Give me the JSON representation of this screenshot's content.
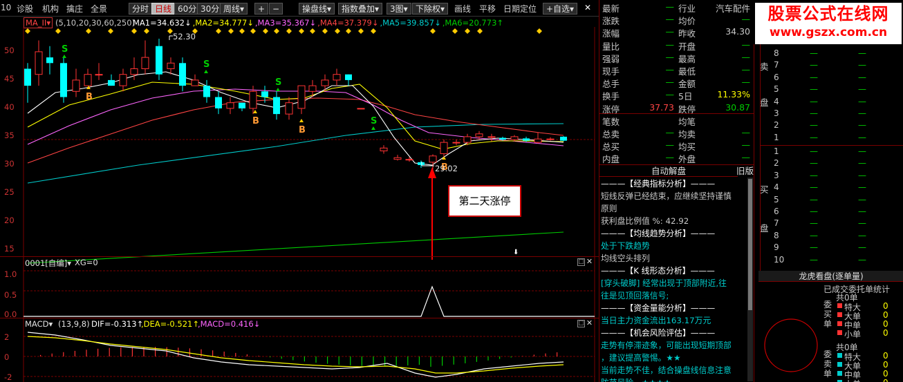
{
  "toolbar": {
    "left_number": "10",
    "items": [
      "诊股",
      "机构",
      "擒庄",
      "全景"
    ],
    "period_buttons": [
      "分时",
      "日线",
      "60分",
      "30分",
      "周线▾"
    ],
    "active_period": "日线",
    "plus": "+",
    "minus": "−",
    "dropdowns": [
      "操盘线▾",
      "指数叠加▾",
      "3图▾",
      "下除权▾"
    ],
    "items2": [
      "画线",
      "平移",
      "日期定位",
      "+自选▾"
    ],
    "close": "✕"
  },
  "main_panel": {
    "indicator_select": "MA_II▾",
    "params": "(5,10,20,30,60,250)",
    "ma_labels": [
      {
        "text": "MA1=34.632↓",
        "color": "#ffffff"
      },
      {
        "text": ",MA2=34.777↓",
        "color": "#ffff00"
      },
      {
        "text": ",MA3=35.367↓",
        "color": "#ff66ff"
      },
      {
        "text": ",MA4=37.379↓",
        "color": "#ff4444"
      },
      {
        "text": ",MA5=39.857↓",
        "color": "#00cccc"
      },
      {
        "text": ",MA6=20.773↑",
        "color": "#00cc00"
      }
    ],
    "y_ticks": [
      "50",
      "45",
      "40",
      "35",
      "30",
      "25",
      "20",
      "15"
    ],
    "high_label": "52.30",
    "low_label": "29.02",
    "annotation": "第二天涨停",
    "s_mark": "S",
    "b_mark": "B"
  },
  "indicator_panel": {
    "title": "0001[自编]▾",
    "xg": "XG=0",
    "y_ticks": [
      "1.0",
      "0.5",
      "0.0"
    ]
  },
  "macd_panel": {
    "name": "MACD▾",
    "params": "(13,9,8)",
    "dif": "DIF=-0.313↑",
    "dea": ",DEA=-0.521↑",
    "macd": ",MACD=0.416↓",
    "y_ticks": [
      "2",
      "0",
      "-2"
    ]
  },
  "quote_table": {
    "rows": [
      {
        "l": "最新",
        "lv": "—",
        "r": "行业",
        "rv": "汽车配件"
      },
      {
        "l": "涨跌",
        "lv": "—",
        "r": "均价",
        "rv": "—"
      },
      {
        "l": "涨幅",
        "lv": "—",
        "r": "昨收",
        "rv": "34.30"
      },
      {
        "l": "量比",
        "lv": "—",
        "r": "开盘",
        "rv": "—"
      },
      {
        "l": "强弱",
        "lv": "—",
        "r": "最高",
        "rv": "—"
      },
      {
        "l": "现手",
        "lv": "—",
        "r": "最低",
        "rv": "—"
      },
      {
        "l": "总手",
        "lv": "—",
        "r": "金额",
        "rv": "—"
      },
      {
        "l": "换手",
        "lv": "—",
        "r": "5日",
        "rv": "11.33%"
      },
      {
        "l": "涨停",
        "lv": "37.73",
        "r": "跌停",
        "rv": "30.87"
      },
      {
        "l": "笔数",
        "lv": "",
        "r": "均笔",
        "rv": ""
      },
      {
        "l": "总卖",
        "lv": "—",
        "r": "均卖",
        "rv": "—"
      },
      {
        "l": "总买",
        "lv": "—",
        "r": "均买",
        "rv": "—"
      },
      {
        "l": "内盘",
        "lv": "—",
        "r": "外盘",
        "rv": "—"
      }
    ]
  },
  "auto_analysis": {
    "title": "自动解盘",
    "old": "旧版",
    "lines": [
      {
        "t": "———【经典指标分析】———",
        "c": "#ffffff"
      },
      {
        "t": "短线反弹已经结束，应继续坚持谨慎",
        "c": "#c8c8c8"
      },
      {
        "t": "原则",
        "c": "#c8c8c8"
      },
      {
        "t": "获利盘比例值 %: 42.92",
        "c": "#c8c8c8"
      },
      {
        "t": "———【均线趋势分析】———",
        "c": "#ffffff"
      },
      {
        "t": "处于下跌趋势",
        "c": "#00cccc"
      },
      {
        "t": "均线空头排列",
        "c": "#c8c8c8"
      },
      {
        "t": "———【K 线形态分析】———",
        "c": "#ffffff"
      },
      {
        "t": "[穿头破脚] 经常出现于顶部附近,往",
        "c": "#00cccc"
      },
      {
        "t": "往是见顶回落信号;",
        "c": "#00cccc"
      },
      {
        "t": "———【资金量能分析】———",
        "c": "#ffffff"
      },
      {
        "t": "当日主力资金流出163.17万元",
        "c": "#00cccc"
      },
      {
        "t": "———【机会风险评估】———",
        "c": "#ffffff"
      },
      {
        "t": "走势有停滞迹象，可能出现短期顶部",
        "c": "#00cccc"
      },
      {
        "t": "，建议提高警惕。★★",
        "c": "#00cccc"
      },
      {
        "t": "当前走势不佳，结合操盘线信息注意",
        "c": "#00cccc"
      },
      {
        "t": "防范风险。★★★★",
        "c": "#00cccc"
      }
    ]
  },
  "orderbook": {
    "sell_label": "卖",
    "sell_label2": "盘",
    "buy_label": "买",
    "buy_label2": "盘",
    "sell_levels": [
      "8",
      "7",
      "6",
      "5",
      "4",
      "3",
      "2",
      "1"
    ],
    "buy_levels": [
      "1",
      "2",
      "3",
      "4",
      "5",
      "6",
      "7",
      "8",
      "9",
      "10"
    ],
    "dash": "—"
  },
  "dragon": {
    "title": "龙虎看盘(逐单量)",
    "subtitle": "已成交委托单统计",
    "group1_label": "委买单",
    "group2_label": "委卖单",
    "total": "共0单",
    "rows": [
      {
        "n": "特大",
        "v": "0"
      },
      {
        "n": "大单",
        "v": "0"
      },
      {
        "n": "中单",
        "v": "0"
      },
      {
        "n": "小单",
        "v": "0"
      }
    ]
  },
  "watermark": {
    "line1": "股票公式在线网",
    "line2": "www.gszx.com.cn"
  }
}
